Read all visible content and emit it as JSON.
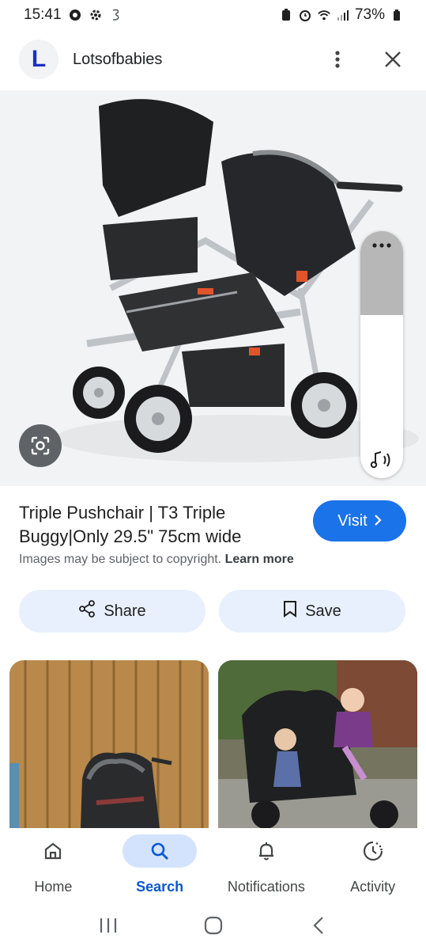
{
  "status_bar": {
    "time": "15:41",
    "battery": "73%",
    "icons_left": [
      "chrome-icon",
      "settings-icon",
      "carrier-icon"
    ],
    "icons_right": [
      "battery-saver-icon",
      "alarm-icon",
      "wifi-icon",
      "signal-icon",
      "battery-icon"
    ]
  },
  "header": {
    "logo_letter": "L",
    "site_name": "Lotsofbabies",
    "more_icon": "more-vert-icon",
    "close_icon": "close-icon"
  },
  "result": {
    "title": "Triple Pushchair | T3 Triple Buggy|Only 29.5\" 75cm wide",
    "visit_label": "Visit",
    "copyright_text": "Images may be subject to copyright.",
    "learn_more": "Learn more"
  },
  "actions": {
    "share_label": "Share",
    "save_label": "Save"
  },
  "bottom_nav": {
    "items": [
      {
        "label": "Home",
        "icon": "home-icon",
        "active": false
      },
      {
        "label": "Search",
        "icon": "search-icon",
        "active": true
      },
      {
        "label": "Notifications",
        "icon": "bell-icon",
        "active": false
      },
      {
        "label": "Activity",
        "icon": "activity-icon",
        "active": false
      }
    ]
  },
  "colors": {
    "accent": "#1a73e8",
    "pill_bg": "#e8f0fe",
    "nav_active_bg": "#d3e3fd",
    "nav_active_text": "#0b57d0"
  }
}
